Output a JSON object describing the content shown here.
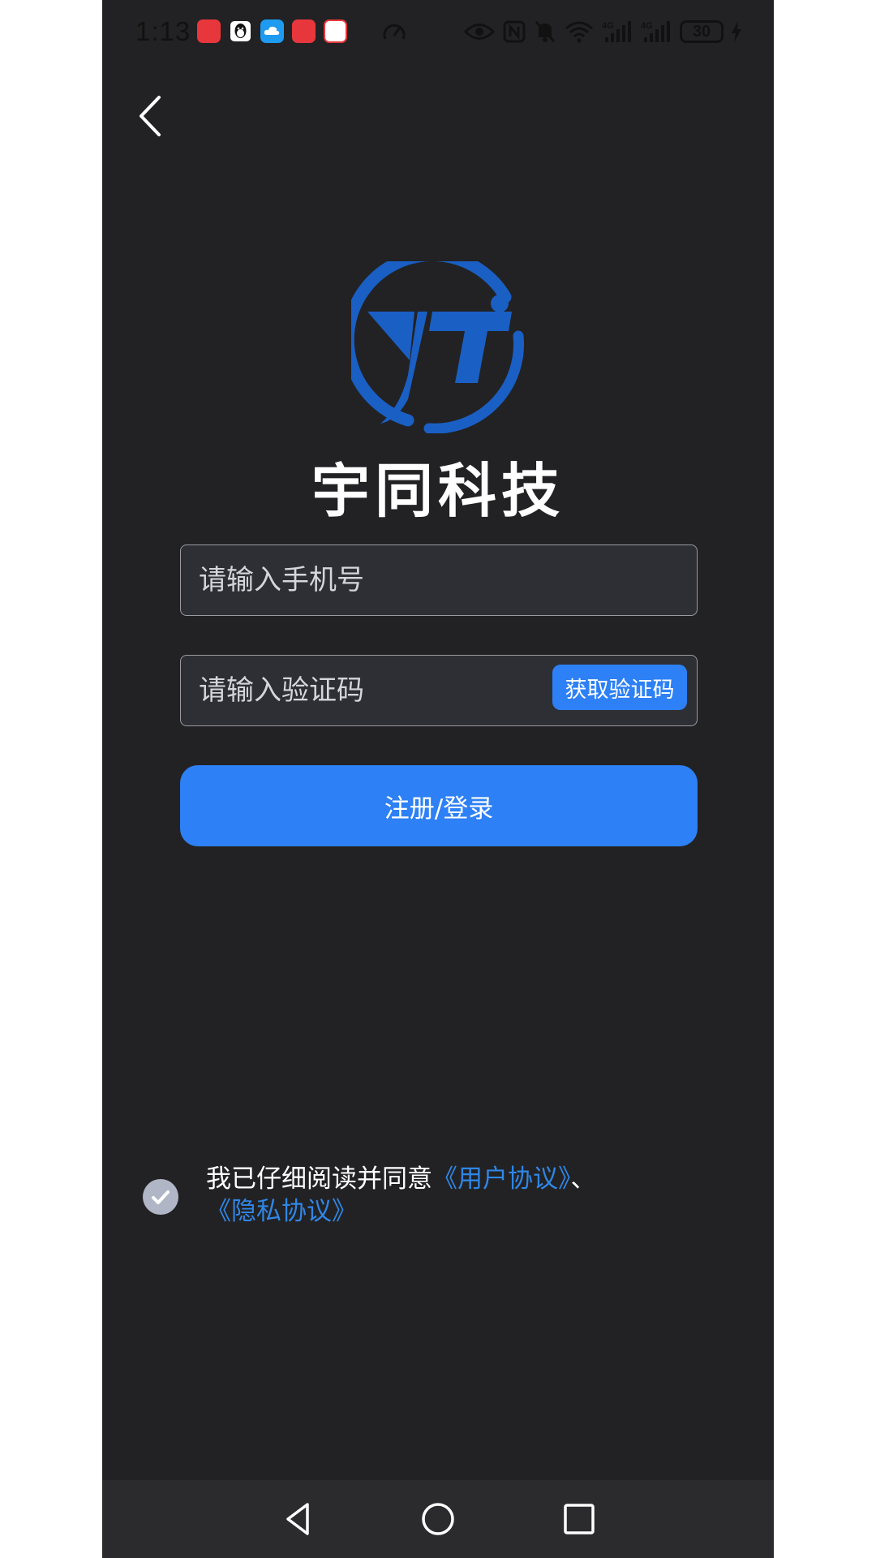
{
  "status_bar": {
    "time": "1:13",
    "battery": "30"
  },
  "brand": {
    "name": "宇同科技",
    "logo_color": "#1a5fc4"
  },
  "form": {
    "phone_placeholder": "请输入手机号",
    "code_placeholder": "请输入验证码",
    "get_code_label": "获取验证码",
    "submit_label": "注册/登录"
  },
  "agreement": {
    "prefix": "我已仔细阅读并同意",
    "user_agreement": "《用户协议》",
    "separator": "、",
    "privacy_policy": "《隐私协议》",
    "checked": true
  },
  "colors": {
    "background": "#222224",
    "primary": "#2d80f5",
    "link": "#2f86e6"
  }
}
